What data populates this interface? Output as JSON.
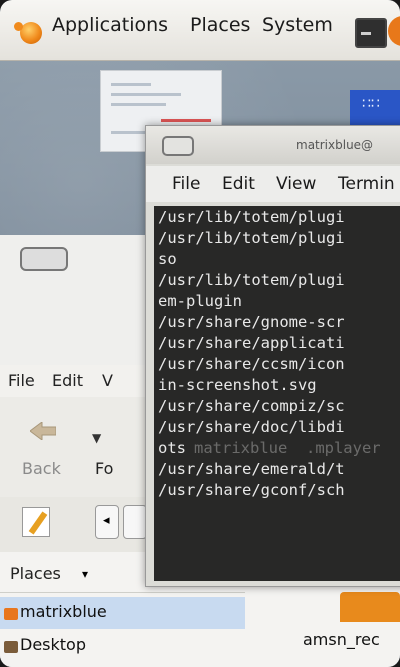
{
  "panel": {
    "applications": "Applications",
    "places": "Places",
    "system": "System"
  },
  "nautilus": {
    "menu": {
      "file": "File",
      "edit": "Edit",
      "view": "V"
    },
    "toolbar": {
      "back": "Back",
      "forward": "Fo"
    },
    "places_header": "Places",
    "places_items": [
      "matrixblue",
      "Desktop"
    ],
    "file_item": "amsn_rec"
  },
  "terminal": {
    "title": "matrixblue@",
    "menu": {
      "file": "File",
      "edit": "Edit",
      "view": "View",
      "terminal": "Termin"
    },
    "lines": [
      "/usr/lib/totem/plugi",
      "/usr/lib/totem/plugi",
      "so",
      "/usr/lib/totem/plugi",
      "em-plugin",
      "/usr/share/gnome-scr",
      "/usr/share/applicati",
      "/usr/share/ccsm/icon",
      "in-screenshot.svg",
      "/usr/share/compiz/sc",
      "/usr/share/doc/libdi",
      "ots",
      "/usr/share/emerald/t",
      "/usr/share/gconf/sch"
    ],
    "ghost_overlay": "matrixblue  .mplayer"
  },
  "colors": {
    "panel": "#e9e7e1",
    "selection": "#c8daf0",
    "terminal_bg": "#000000",
    "accent_orange": "#e8781a"
  }
}
